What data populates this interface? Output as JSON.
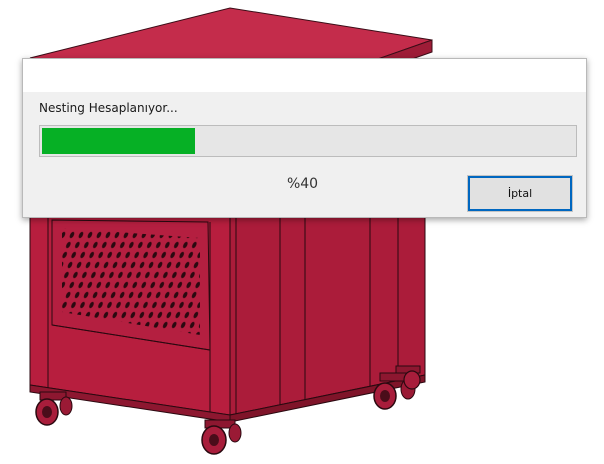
{
  "dialog": {
    "status_text": "Nesting Hesaplanıyor...",
    "progress_fraction": 0.4,
    "percent_text": "%40",
    "cancel_label": "İptal"
  },
  "colors": {
    "cabinet": "#b1203f",
    "progress_fill": "#06b025",
    "progress_track": "#e6e6e6",
    "button_focus": "#0067c0"
  }
}
